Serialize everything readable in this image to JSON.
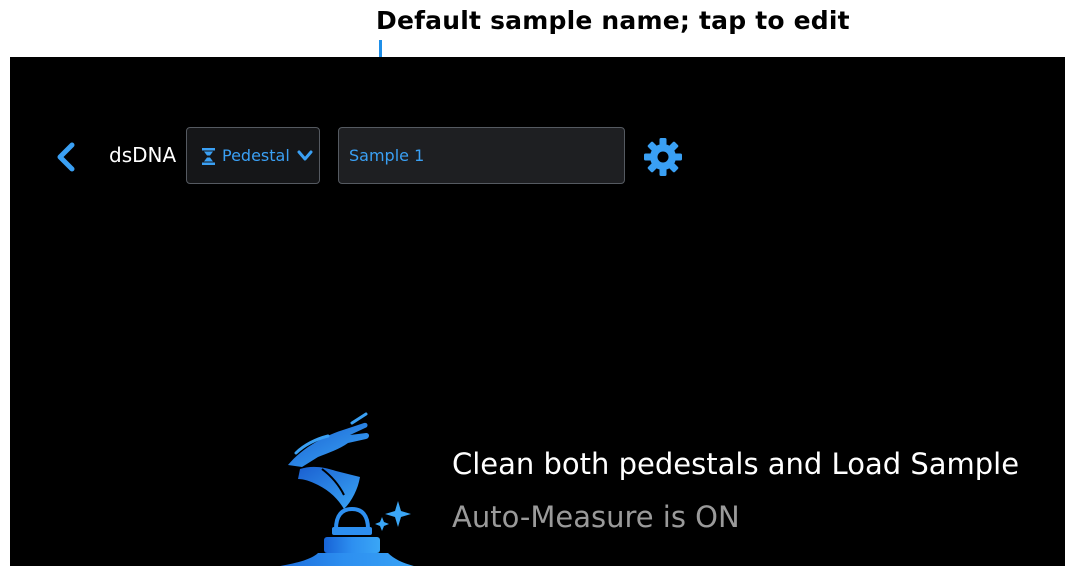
{
  "annotation": {
    "callout_text": "Default sample name; tap to edit"
  },
  "header": {
    "app_label": "dsDNA",
    "pedestal_select": {
      "selected": "Pedestal"
    },
    "sample_name": {
      "value": "Sample 1"
    }
  },
  "main": {
    "instruction": "Clean both pedestals and Load Sample",
    "status": "Auto-Measure is ON"
  },
  "icons": {
    "back": "chevron-left-icon",
    "pedestal": "pedestal-icon",
    "dropdown": "chevron-down-icon",
    "settings": "gear-icon",
    "illustration": "clean-pedestal-illustration"
  },
  "colors": {
    "accent": "#3aa0f4",
    "callout_line": "#1f8fe8",
    "screen_background": "#000000",
    "field_border": "#555a61",
    "secondary_text": "#9a9a9a"
  }
}
